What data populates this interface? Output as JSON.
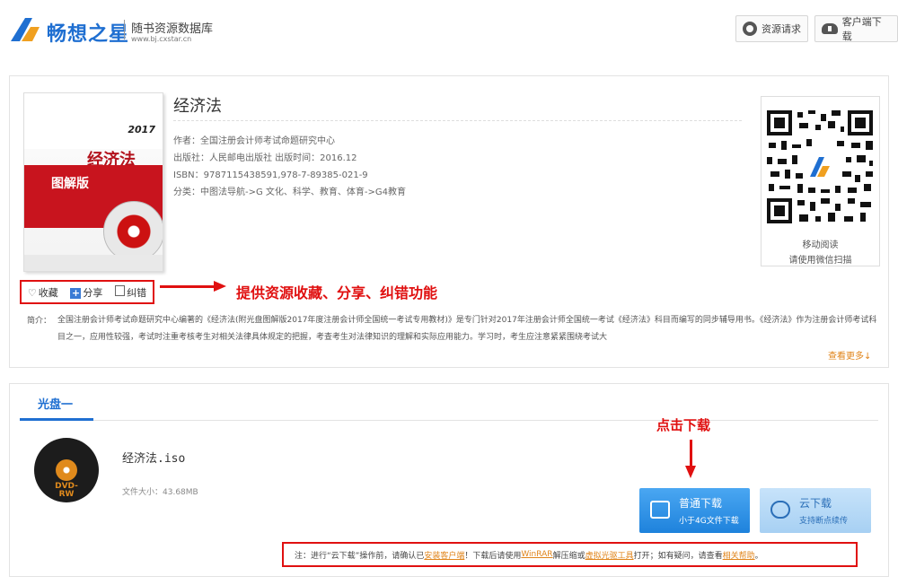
{
  "header": {
    "logo_text": "畅想之星",
    "logo_subtitle": "随书资源数据库",
    "logo_url": "www.bj.cxstar.cn",
    "request_button": "资源请求",
    "client_download_button": "客户端下载"
  },
  "book": {
    "cover": {
      "year": "2017",
      "title": "经济法",
      "tag": "图解版"
    },
    "title": "经济法",
    "author": "作者：全国注册会计师考试命题研究中心",
    "publisher": "出版社：人民邮电出版社 出版时间：2016.12",
    "isbn": "ISBN：9787115438591,978-7-89385-021-9",
    "category": "分类：中图法导航->G 文化、科学、教育、体育->G4教育",
    "actions": {
      "favorite": "收藏",
      "share": "分享",
      "report": "纠错"
    },
    "summary_label": "简介：",
    "summary": "全国注册会计师考试命题研究中心编著的《经济法(附光盘图解版2017年度注册会计师全国统一考试专用教材)》是专门针对2017年注册会计师全国统一考试《经济法》科目而编写的同步辅导用书。《经济法》作为注册会计师考试科目之一，应用性较强，考试时注重考核考生对相关法律具体规定的把握，考查考生对法律知识的理解和实际应用能力。学习时，考生应注意紧紧围绕考试大",
    "more_link": "查看更多↓"
  },
  "qr": {
    "line1": "移动阅读",
    "line2": "请使用微信扫描"
  },
  "annotations": {
    "features": "提供资源收藏、分享、纠错功能",
    "click_download": "点击下载"
  },
  "disc": {
    "tab_label": "光盘一",
    "dvd_label": "DVD-RW",
    "file_name": "经济法.iso",
    "file_size": "文件大小：43.68MB",
    "normal_download": {
      "label": "普通下载",
      "sub": "小于4G文件下载"
    },
    "cloud_download": {
      "label": "云下载",
      "sub": "支持断点续传"
    },
    "note": {
      "prefix": "注：进行“云下载”操作前，请确认已",
      "link1": "安装客户端",
      "mid1": "！下载后请使用",
      "link2": "WinRAR",
      "mid2": "解压缩或",
      "link3": "虚拟光驱工具",
      "mid3": "打开；如有疑问，请查看",
      "link4": "相关帮助",
      "suffix": "。"
    }
  },
  "colors": {
    "brand_blue": "#1f6fd1",
    "annotation_red": "#e01010",
    "link_orange": "#e0841a"
  }
}
